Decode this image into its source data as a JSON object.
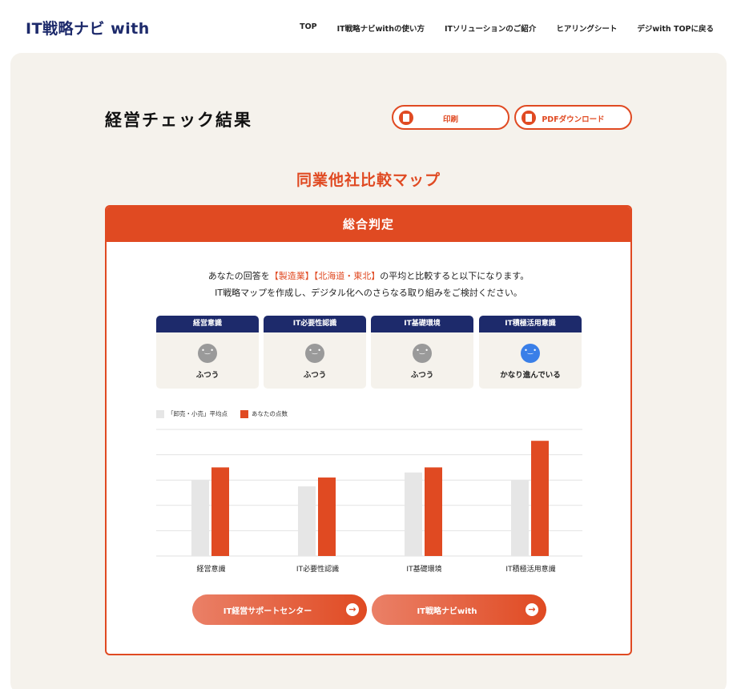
{
  "header": {
    "logo": "IT戦略ナビ with",
    "nav": [
      "TOP",
      "IT戦略ナビwithの使い方",
      "ITソリューションのご紹介",
      "ヒアリングシート",
      "デジwith TOPに戻る"
    ]
  },
  "page": {
    "title": "経営チェック結果",
    "print_label": "印刷",
    "pdf_label": "PDFダウンロード",
    "section_title": "同業他社比較マップ"
  },
  "card": {
    "heading": "総合判定",
    "intro_a": "あなたの回答を",
    "industry": "【製造業】",
    "region": "【北海道・東北】",
    "intro_b": "の平均と比較すると以下になります。",
    "intro_line2": "IT戦略マップを作成し、デジタル化へのさらなる取り組みをご検討ください。"
  },
  "tiles": [
    {
      "title": "経営意識",
      "value": "ふつう",
      "icon": "neutral-face-icon"
    },
    {
      "title": "IT必要性認識",
      "value": "ふつう",
      "icon": "neutral-face-icon"
    },
    {
      "title": "IT基礎環境",
      "value": "ふつう",
      "icon": "neutral-face-icon"
    },
    {
      "title": "IT積極活用意識",
      "value": "かなり進んでいる",
      "icon": "happy-face-icon"
    }
  ],
  "legend": {
    "average_label": "「卸売・小売」平均点",
    "yours_label": "あなたの点数"
  },
  "colors": {
    "accent": "#e04a22",
    "navy": "#1d2a6b",
    "average_bar": "#e6e6e6",
    "panel_bg": "#f5f2ec",
    "active_face": "#3a7fe8"
  },
  "chart_data": {
    "type": "bar",
    "categories": [
      "経営意識",
      "IT必要性認識",
      "IT基礎環境",
      "IT積極活用意識"
    ],
    "series": [
      {
        "name": "「卸売・小売」平均点",
        "values": [
          3.0,
          2.75,
          3.3,
          3.0
        ]
      },
      {
        "name": "あなたの点数",
        "values": [
          3.5,
          3.1,
          3.5,
          4.55
        ]
      }
    ],
    "ylim": [
      0,
      5
    ],
    "grid": true,
    "legend": "top-left"
  },
  "actions": {
    "support_label": "IT経営サポートセンター",
    "navi_label": "IT戦略ナビwith"
  }
}
